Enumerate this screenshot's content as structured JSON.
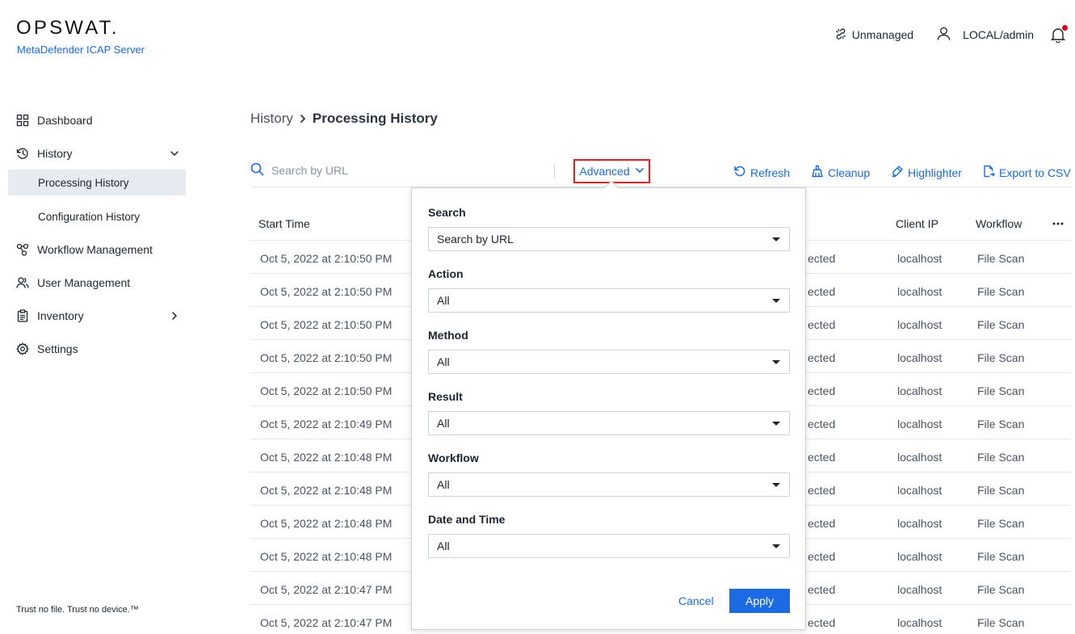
{
  "brand": {
    "logo": "OPSWAT.",
    "product": "MetaDefender ICAP Server"
  },
  "topbar": {
    "unmanaged": "Unmanaged",
    "user": "LOCAL/admin",
    "notification_badge_color": "#d9001b"
  },
  "sidebar": {
    "items": [
      {
        "label": "Dashboard",
        "icon": "dashboard-icon"
      },
      {
        "label": "History",
        "icon": "history-icon",
        "expanded": true
      },
      {
        "label": "Processing History",
        "active": true
      },
      {
        "label": "Configuration History"
      },
      {
        "label": "Workflow Management",
        "icon": "workflow-icon"
      },
      {
        "label": "User Management",
        "icon": "users-icon"
      },
      {
        "label": "Inventory",
        "icon": "inventory-icon"
      },
      {
        "label": "Settings",
        "icon": "gear-icon"
      }
    ],
    "tagline": "Trust no file. Trust no device.™"
  },
  "breadcrumb": {
    "root": "History",
    "current": "Processing History"
  },
  "toolbar": {
    "search_placeholder": "Search by URL",
    "advanced": "Advanced",
    "refresh": "Refresh",
    "cleanup": "Cleanup",
    "highlighter": "Highlighter",
    "export": "Export to CSV"
  },
  "table": {
    "headers": {
      "start_time": "Start Time",
      "client_ip": "Client IP",
      "workflow": "Workflow"
    },
    "rows": [
      {
        "time": "Oct 5, 2022 at 2:10:50 PM",
        "result": "ected",
        "ip": "localhost",
        "workflow": "File Scan"
      },
      {
        "time": "Oct 5, 2022 at 2:10:50 PM",
        "result": "ected",
        "ip": "localhost",
        "workflow": "File Scan"
      },
      {
        "time": "Oct 5, 2022 at 2:10:50 PM",
        "result": "ected",
        "ip": "localhost",
        "workflow": "File Scan"
      },
      {
        "time": "Oct 5, 2022 at 2:10:50 PM",
        "result": "ected",
        "ip": "localhost",
        "workflow": "File Scan"
      },
      {
        "time": "Oct 5, 2022 at 2:10:50 PM",
        "result": "ected",
        "ip": "localhost",
        "workflow": "File Scan"
      },
      {
        "time": "Oct 5, 2022 at 2:10:49 PM",
        "result": "ected",
        "ip": "localhost",
        "workflow": "File Scan"
      },
      {
        "time": "Oct 5, 2022 at 2:10:48 PM",
        "result": "ected",
        "ip": "localhost",
        "workflow": "File Scan"
      },
      {
        "time": "Oct 5, 2022 at 2:10:48 PM",
        "result": "ected",
        "ip": "localhost",
        "workflow": "File Scan"
      },
      {
        "time": "Oct 5, 2022 at 2:10:48 PM",
        "result": "ected",
        "ip": "localhost",
        "workflow": "File Scan"
      },
      {
        "time": "Oct 5, 2022 at 2:10:48 PM",
        "result": "ected",
        "ip": "localhost",
        "workflow": "File Scan"
      },
      {
        "time": "Oct 5, 2022 at 2:10:47 PM",
        "result": "ected",
        "ip": "localhost",
        "workflow": "File Scan"
      },
      {
        "time": "Oct 5, 2022 at 2:10:47 PM",
        "result": "ected",
        "ip": "localhost",
        "workflow": "File Scan"
      }
    ]
  },
  "advanced_panel": {
    "fields": [
      {
        "label": "Search",
        "value": "Search by URL"
      },
      {
        "label": "Action",
        "value": "All"
      },
      {
        "label": "Method",
        "value": "All"
      },
      {
        "label": "Result",
        "value": "All"
      },
      {
        "label": "Workflow",
        "value": "All"
      },
      {
        "label": "Date and Time",
        "value": "All"
      }
    ],
    "cancel": "Cancel",
    "apply": "Apply"
  },
  "colors": {
    "accent": "#1d6ae5",
    "highlight_border": "#e02020",
    "active_nav_bg": "#e6eaf1"
  }
}
